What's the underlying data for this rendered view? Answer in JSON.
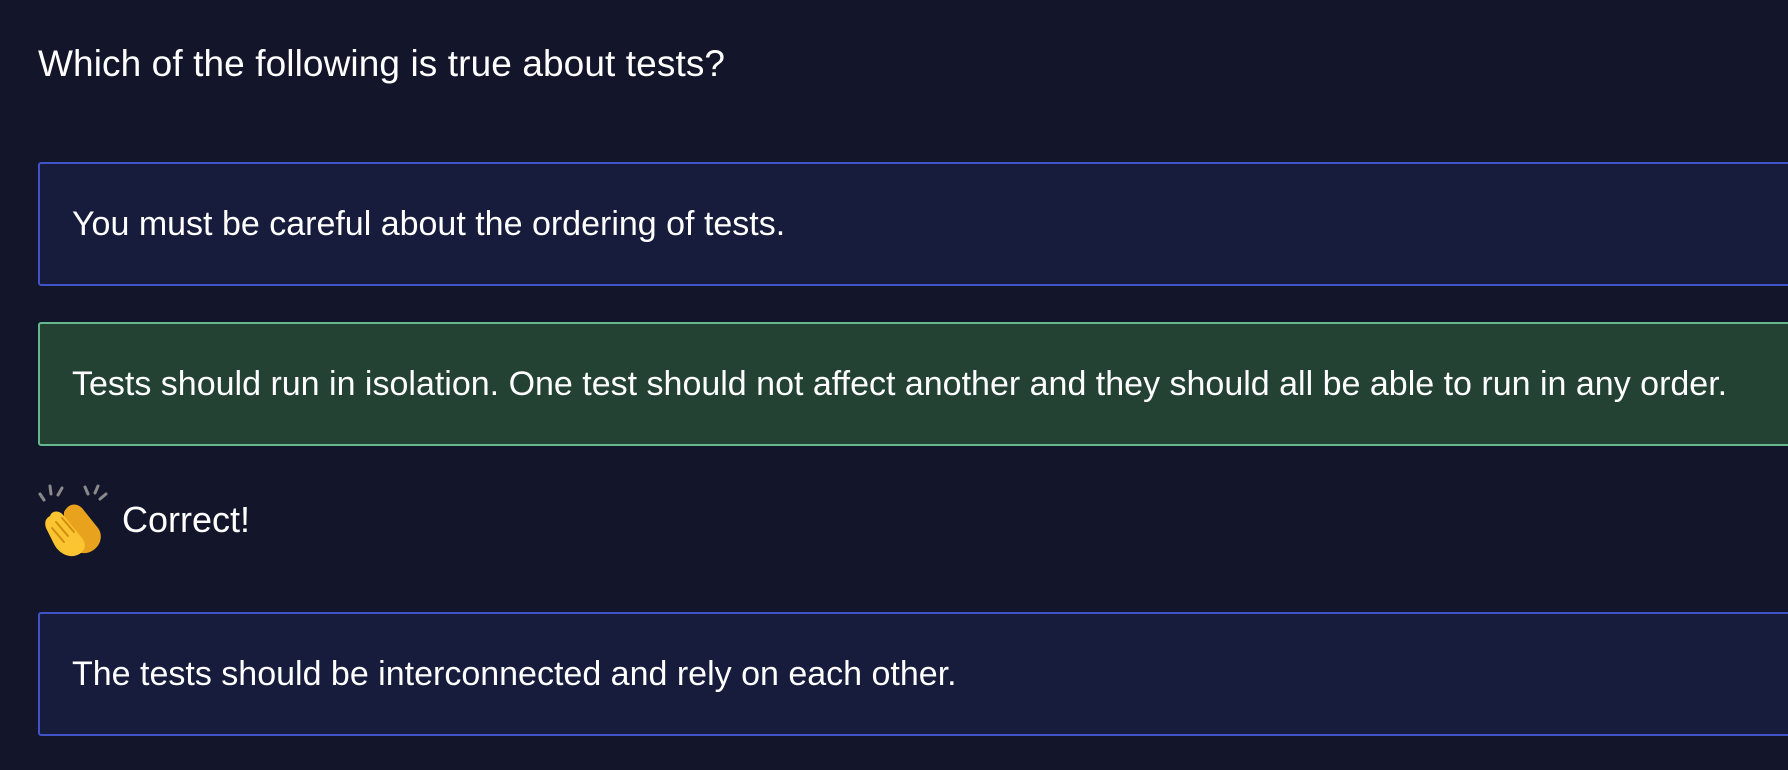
{
  "quiz": {
    "question": "Which of the following is true about tests?",
    "options": [
      {
        "label": "You must be careful about the ordering of tests.",
        "state": "default"
      },
      {
        "label": "Tests should run in isolation. One test should not affect another and they should all be able to run in any order.",
        "state": "correct"
      },
      {
        "label": "The tests should be interconnected and rely on each other.",
        "state": "default"
      }
    ],
    "feedback": {
      "icon": "clapping-hands-icon",
      "text": "Correct!"
    }
  },
  "colors": {
    "background": "#13162b",
    "option_border": "#4054c8",
    "option_background": "#171b3c",
    "correct_background": "#234234",
    "correct_border": "#63b98d"
  }
}
